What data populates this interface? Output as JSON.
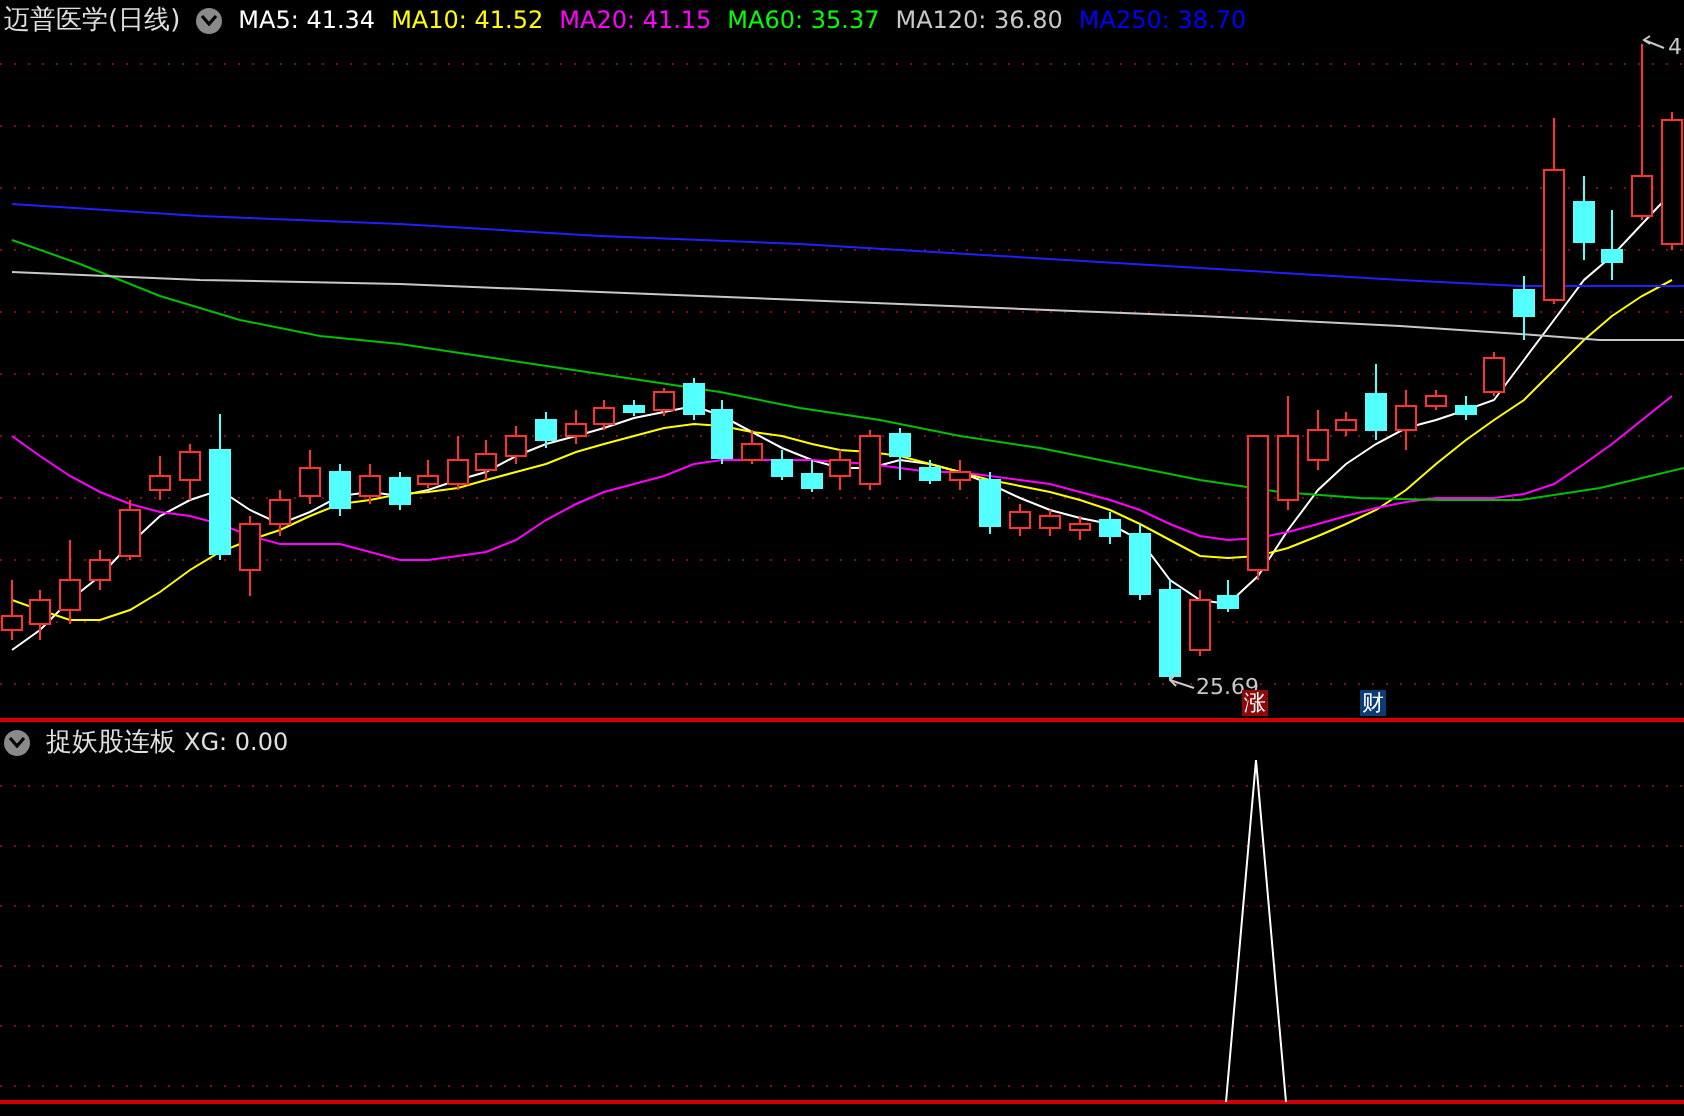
{
  "main_panel": {
    "title": "迈普医学(日线)",
    "indicators": [
      {
        "text": "MA5: 41.34",
        "color": "#ffffff"
      },
      {
        "text": "MA10: 41.52",
        "color": "#ffff00"
      },
      {
        "text": "MA20: 41.15",
        "color": "#ff00ff"
      },
      {
        "text": "MA60: 35.37",
        "color": "#00ff00"
      },
      {
        "text": "MA120: 36.80",
        "color": "#c8c8c8"
      },
      {
        "text": "MA250: 38.70",
        "color": "#0000ff"
      }
    ],
    "low_label": "25.69",
    "high_label": "4",
    "badges": [
      {
        "text": "涨",
        "color": "#8b0a0a"
      },
      {
        "text": "财",
        "color": "#0b3c73"
      }
    ]
  },
  "sub_panel": {
    "title": "捉妖股连板",
    "reading": "XG: 0.00"
  }
}
